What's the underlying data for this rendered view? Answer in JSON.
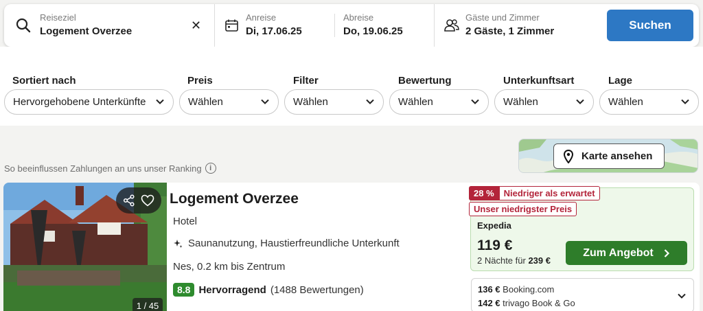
{
  "search": {
    "destination_label": "Reiseziel",
    "destination_value": "Logement Overzee",
    "clear_symbol": "✕",
    "checkin_label": "Anreise",
    "checkin_value": "Di, 17.06.25",
    "checkout_label": "Abreise",
    "checkout_value": "Do, 19.06.25",
    "guests_label": "Gäste und Zimmer",
    "guests_value": "2 Gäste, 1 Zimmer",
    "search_button": "Suchen",
    "icons": [
      "search-icon",
      "calendar-icon",
      "guests-icon"
    ]
  },
  "filters": [
    {
      "label": "Sortiert nach",
      "value": "Hervorgehobene Unterkünfte"
    },
    {
      "label": "Preis",
      "value": "Wählen"
    },
    {
      "label": "Filter",
      "value": "Wählen"
    },
    {
      "label": "Bewertung",
      "value": "Wählen"
    },
    {
      "label": "Unterkunftsart",
      "value": "Wählen"
    },
    {
      "label": "Lage",
      "value": "Wählen"
    }
  ],
  "ranking_note": "So beeinflussen Zahlungen an uns unser Ranking",
  "ranking_info_symbol": "i",
  "map_button": "Karte ansehen",
  "hotel": {
    "name": "Logement Overzee",
    "type": "Hotel",
    "amenities": "Saunanutzung, Haustierfreundliche Unterkunft",
    "location": "Nes, 0.2 km bis Zentrum",
    "rating_score": "8.8",
    "rating_word": "Hervorragend",
    "rating_count": "(1488 Bewertungen)",
    "photo_counter": "1 / 45"
  },
  "deal": {
    "discount_pct": "28 %",
    "discount_text": "Niedriger als erwartet",
    "lowest_tag": "Unser niedrigster Preis",
    "provider": "Expedia",
    "price": "119 €",
    "nights_text": "2 Nächte für",
    "nights_total": "239 €",
    "offer_button": "Zum Angebot"
  },
  "other_offers": [
    {
      "price": "136 €",
      "provider": "Booking.com"
    },
    {
      "price": "142 €",
      "provider": "trivago Book & Go"
    }
  ],
  "colors": {
    "primary_button": "#2d78c4",
    "offer_button": "#2e7d2a",
    "rating_badge": "#2e8b2e",
    "discount_red": "#b3243a",
    "deal_background": "#eef8ea"
  }
}
